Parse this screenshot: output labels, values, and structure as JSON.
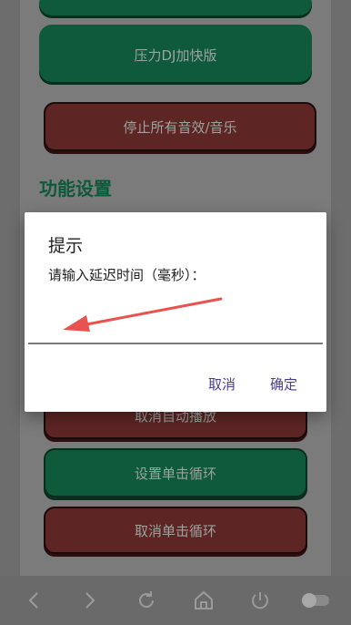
{
  "buttons": {
    "top_partial": "",
    "pressure_dj": "压力DJ加快版",
    "stop_all": "停止所有音效/音乐",
    "cancel_auto_play": "取消自动播放",
    "set_single_loop": "设置单击循环",
    "cancel_single_loop": "取消单击循环"
  },
  "section": {
    "title": "功能设置"
  },
  "dialog": {
    "title": "提示",
    "message": "请输入延迟时间（毫秒）：",
    "input_value": "",
    "cancel_label": "取消",
    "ok_label": "确定"
  },
  "navbar": {
    "icons": [
      "back-icon",
      "forward-icon",
      "refresh-icon",
      "home-icon",
      "power-icon",
      "toggle-icon"
    ]
  },
  "colors": {
    "green_button": "#0f5a3a",
    "red_button": "#5e2525",
    "dialog_accent": "#4a3d8f",
    "arrow": "#e8524f"
  }
}
